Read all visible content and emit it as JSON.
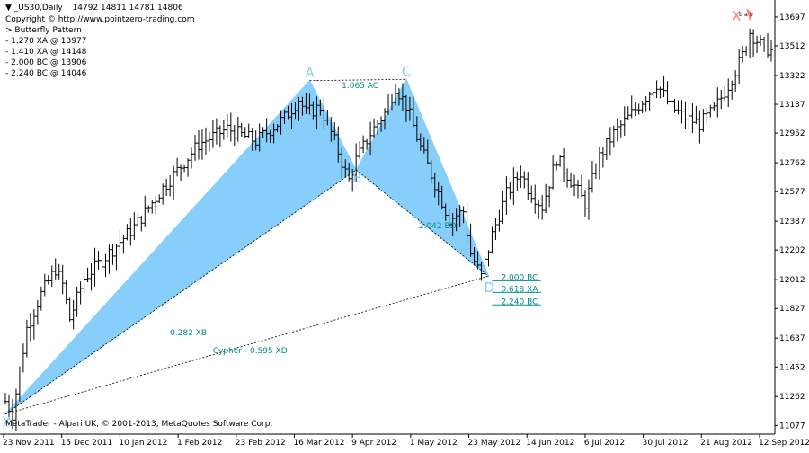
{
  "window": {
    "menu_glyph": "▼",
    "symbol": "_US30,Daily",
    "ohlc": "14792 14811 14781 14806"
  },
  "info": {
    "copyright": "Copyright © http://www.pointzero-trading.com",
    "pattern": "> Butterfly Pattern",
    "levels": [
      "- 1.270 XA @ 13977",
      "- 1.410 XA @ 14148",
      "- 2.000 BC @ 13906",
      "- 2.240 BC @ 14046"
    ]
  },
  "footer": "MetaTrader - Alpari UK, © 2001-2013, MetaQuotes Software Corp.",
  "colors": {
    "background": "#ffffff",
    "candles": "#000000",
    "pattern_fill": "#87cefa",
    "pattern_label": "#87cefa",
    "ratio_label": "#008b8b",
    "dashed_line": "#000000",
    "x_marker": "#fa8072"
  },
  "chart_data": {
    "type": "ohlc-bar",
    "price_axis": {
      "ticks": [
        13697,
        13512,
        13322,
        13137,
        12952,
        12762,
        12577,
        12387,
        12202,
        12012,
        11827,
        11637,
        11452,
        11262,
        11077
      ],
      "ylim": [
        11050,
        13760
      ]
    },
    "time_axis": {
      "ticks": [
        "23 Nov 2011",
        "15 Dec 2011",
        "10 Jan 2012",
        "1 Feb 2012",
        "23 Feb 2012",
        "16 Mar 2012",
        "9 Apr 2012",
        "1 May 2012",
        "23 May 2012",
        "14 Jun 2012",
        "6 Jul 2012",
        "30 Jul 2012",
        "21 Aug 2012",
        "12 Sep 2012"
      ],
      "bar_count": 215
    },
    "close_anchors": [
      {
        "bar": 0,
        "close": 11231
      },
      {
        "bar": 2,
        "close": 11150
      },
      {
        "bar": 6,
        "close": 11700
      },
      {
        "bar": 10,
        "close": 11920
      },
      {
        "bar": 14,
        "close": 12080
      },
      {
        "bar": 16,
        "close": 11980
      },
      {
        "bar": 18,
        "close": 11760
      },
      {
        "bar": 22,
        "close": 12020
      },
      {
        "bar": 28,
        "close": 12160
      },
      {
        "bar": 36,
        "close": 12350
      },
      {
        "bar": 44,
        "close": 12600
      },
      {
        "bar": 54,
        "close": 12880
      },
      {
        "bar": 62,
        "close": 12980
      },
      {
        "bar": 70,
        "close": 12900
      },
      {
        "bar": 78,
        "close": 13050
      },
      {
        "bar": 82,
        "close": 13170
      },
      {
        "bar": 84,
        "close": 13080
      },
      {
        "bar": 88,
        "close": 13120
      },
      {
        "bar": 92,
        "close": 12900
      },
      {
        "bar": 95,
        "close": 12700
      },
      {
        "bar": 96,
        "close": 12650
      },
      {
        "bar": 98,
        "close": 12780
      },
      {
        "bar": 102,
        "close": 12950
      },
      {
        "bar": 106,
        "close": 13080
      },
      {
        "bar": 109,
        "close": 13250
      },
      {
        "bar": 112,
        "close": 13130
      },
      {
        "bar": 116,
        "close": 12860
      },
      {
        "bar": 120,
        "close": 12630
      },
      {
        "bar": 124,
        "close": 12400
      },
      {
        "bar": 128,
        "close": 12450
      },
      {
        "bar": 130,
        "close": 12180
      },
      {
        "bar": 133,
        "close": 12030
      },
      {
        "bar": 136,
        "close": 12300
      },
      {
        "bar": 140,
        "close": 12560
      },
      {
        "bar": 144,
        "close": 12700
      },
      {
        "bar": 146,
        "close": 12600
      },
      {
        "bar": 150,
        "close": 12480
      },
      {
        "bar": 154,
        "close": 12790
      },
      {
        "bar": 158,
        "close": 12650
      },
      {
        "bar": 162,
        "close": 12500
      },
      {
        "bar": 166,
        "close": 12800
      },
      {
        "bar": 170,
        "close": 12950
      },
      {
        "bar": 174,
        "close": 13050
      },
      {
        "bar": 178,
        "close": 13160
      },
      {
        "bar": 182,
        "close": 13270
      },
      {
        "bar": 186,
        "close": 13120
      },
      {
        "bar": 190,
        "close": 13050
      },
      {
        "bar": 194,
        "close": 13010
      },
      {
        "bar": 198,
        "close": 13100
      },
      {
        "bar": 202,
        "close": 13260
      },
      {
        "bar": 206,
        "close": 13450
      },
      {
        "bar": 208,
        "close": 13600
      },
      {
        "bar": 211,
        "close": 13520
      },
      {
        "bar": 214,
        "close": 13480
      }
    ],
    "points": [
      {
        "label": "X",
        "bar": 0,
        "price": 11150
      },
      {
        "label": "A",
        "bar": 85,
        "price": 13289
      },
      {
        "label": "B",
        "bar": 98,
        "price": 12716
      },
      {
        "label": "C",
        "bar": 112,
        "price": 13297
      },
      {
        "label": "D",
        "bar": 135,
        "price": 12035
      },
      {
        "label": "X",
        "bar": 208,
        "price": 13697
      }
    ],
    "ratio_labels": [
      "1.065 AC",
      "2.042 BD",
      "0.282 XB",
      "Cypher - 0.595 XD"
    ],
    "target_levels": [
      {
        "label": "2.000 BC",
        "price": 12005
      },
      {
        "label": "0.618 XA",
        "price": 11930
      },
      {
        "label": "2.240 BC",
        "price": 11850
      }
    ],
    "mini_labels": [
      "b",
      "a",
      "c"
    ]
  }
}
